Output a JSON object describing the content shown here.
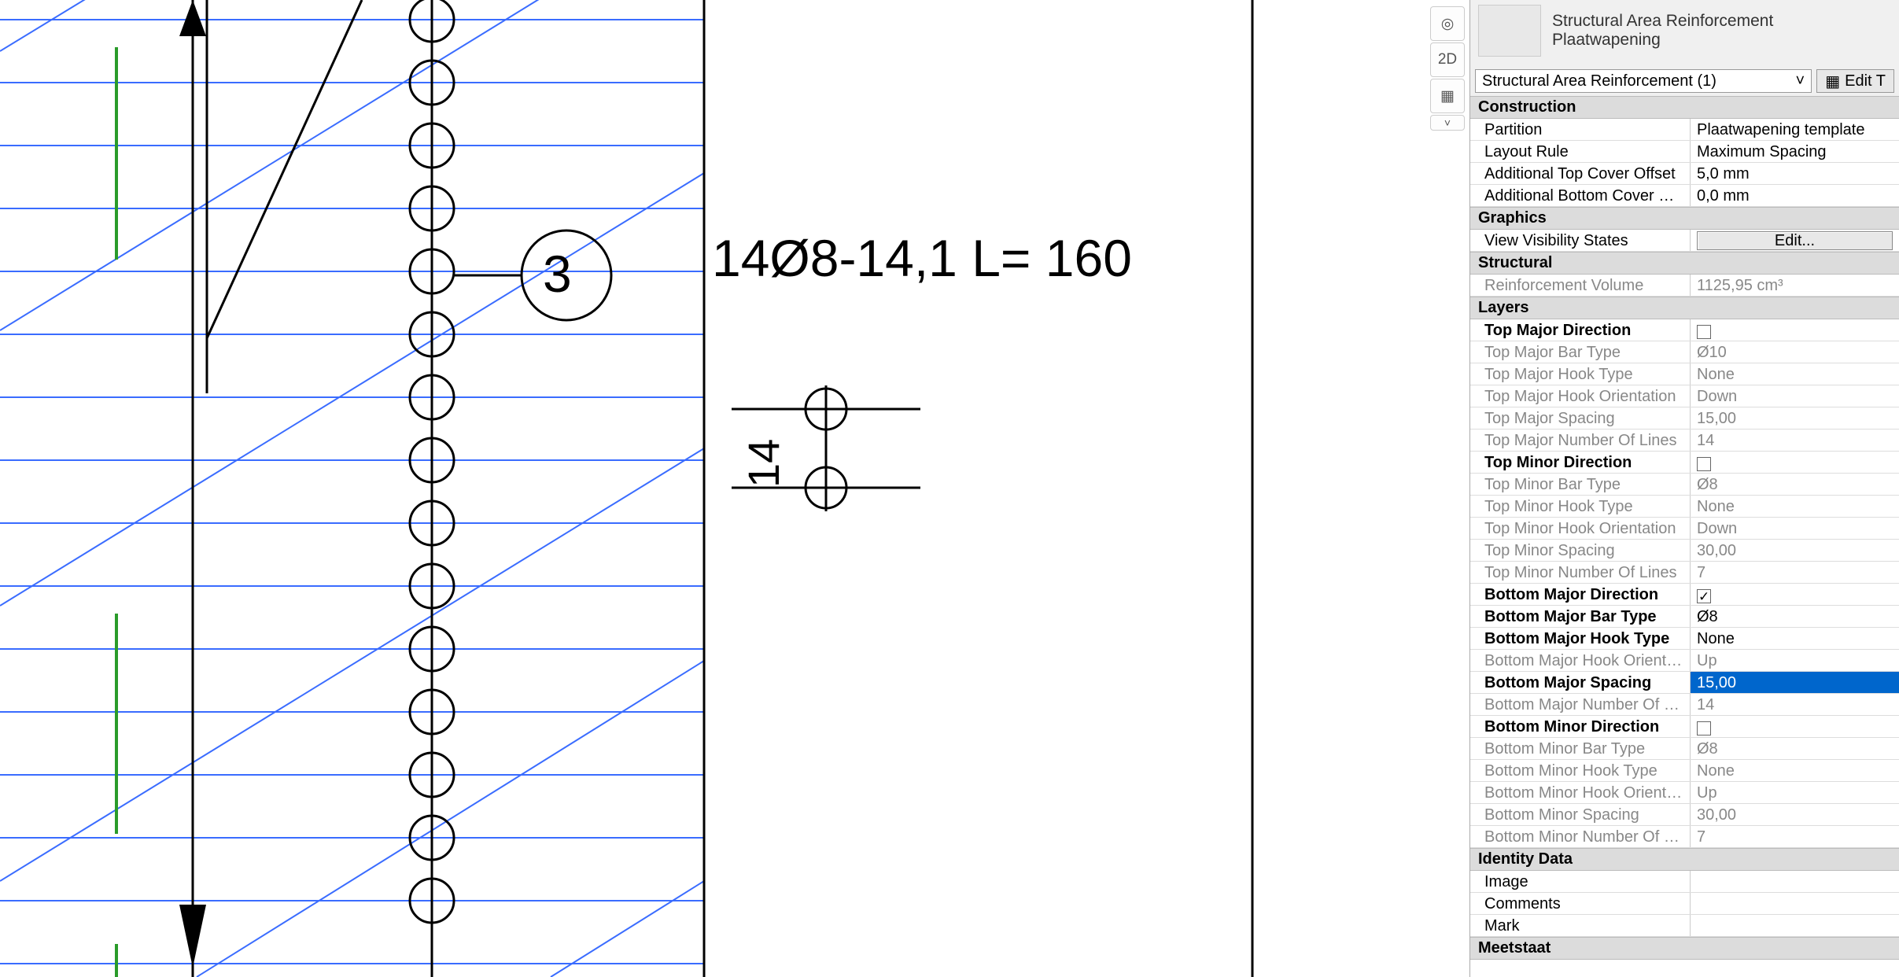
{
  "type_header": {
    "title1": "Structural Area Reinforcement",
    "title2": "Plaatwapening"
  },
  "type_selector": "Structural Area Reinforcement (1)",
  "edit_type_label": "Edit T",
  "nav": {
    "home_tip": "◎",
    "view2d": "2D",
    "navcube": "▦",
    "chevron": "˅"
  },
  "drawing": {
    "annotation": "14Ø8-14,1 L= 160",
    "bubble_num": "3",
    "dim_value": "14"
  },
  "groups": [
    {
      "kind": "group",
      "label": "Construction"
    },
    {
      "kind": "prop",
      "label": "Partition",
      "value": "Plaatwapening template",
      "bold": false
    },
    {
      "kind": "prop",
      "label": "Layout Rule",
      "value": "Maximum Spacing",
      "bold": false
    },
    {
      "kind": "prop",
      "label": "Additional Top Cover Offset",
      "value": "5,0 mm",
      "bold": false
    },
    {
      "kind": "prop",
      "label": "Additional Bottom Cover Offset",
      "value": "0,0 mm",
      "bold": false
    },
    {
      "kind": "group",
      "label": "Graphics"
    },
    {
      "kind": "prop",
      "label": "View Visibility States",
      "value": "Edit...",
      "button": true
    },
    {
      "kind": "group",
      "label": "Structural"
    },
    {
      "kind": "prop",
      "label": "Reinforcement Volume",
      "value": "1125,95 cm³",
      "dimlabel": true,
      "dimvalue": true
    },
    {
      "kind": "group",
      "label": "Layers"
    },
    {
      "kind": "prop",
      "label": "Top Major Direction",
      "value": "",
      "checkbox": true,
      "checked": false,
      "bold": true
    },
    {
      "kind": "prop",
      "label": "Top Major Bar Type",
      "value": "Ø10",
      "dimlabel": true,
      "dimvalue": true
    },
    {
      "kind": "prop",
      "label": "Top Major Hook Type",
      "value": "None",
      "dimlabel": true,
      "dimvalue": true
    },
    {
      "kind": "prop",
      "label": "Top Major Hook Orientation",
      "value": "Down",
      "dimlabel": true,
      "dimvalue": true
    },
    {
      "kind": "prop",
      "label": "Top Major Spacing",
      "value": "15,00",
      "dimlabel": true,
      "dimvalue": true
    },
    {
      "kind": "prop",
      "label": "Top Major Number Of Lines",
      "value": "14",
      "dimlabel": true,
      "dimvalue": true
    },
    {
      "kind": "prop",
      "label": "Top Minor Direction",
      "value": "",
      "checkbox": true,
      "checked": false,
      "bold": true
    },
    {
      "kind": "prop",
      "label": "Top Minor Bar Type",
      "value": "Ø8",
      "dimlabel": true,
      "dimvalue": true
    },
    {
      "kind": "prop",
      "label": "Top Minor Hook Type",
      "value": "None",
      "dimlabel": true,
      "dimvalue": true
    },
    {
      "kind": "prop",
      "label": "Top Minor Hook Orientation",
      "value": "Down",
      "dimlabel": true,
      "dimvalue": true
    },
    {
      "kind": "prop",
      "label": "Top Minor Spacing",
      "value": "30,00",
      "dimlabel": true,
      "dimvalue": true
    },
    {
      "kind": "prop",
      "label": "Top Minor Number Of Lines",
      "value": "7",
      "dimlabel": true,
      "dimvalue": true
    },
    {
      "kind": "prop",
      "label": "Bottom Major Direction",
      "value": "",
      "checkbox": true,
      "checked": true,
      "bold": true
    },
    {
      "kind": "prop",
      "label": "Bottom Major Bar Type",
      "value": "Ø8",
      "bold": true
    },
    {
      "kind": "prop",
      "label": "Bottom Major Hook Type",
      "value": "None",
      "bold": true
    },
    {
      "kind": "prop",
      "label": "Bottom Major Hook Orientati...",
      "value": "Up",
      "dimlabel": true,
      "dimvalue": true
    },
    {
      "kind": "prop",
      "label": "Bottom Major Spacing",
      "value": "15,00",
      "bold": true,
      "highlight": true
    },
    {
      "kind": "prop",
      "label": "Bottom Major Number Of Lines",
      "value": "14",
      "dimlabel": true,
      "dimvalue": true
    },
    {
      "kind": "prop",
      "label": "Bottom Minor Direction",
      "value": "",
      "checkbox": true,
      "checked": false,
      "bold": true
    },
    {
      "kind": "prop",
      "label": "Bottom Minor Bar Type",
      "value": "Ø8",
      "dimlabel": true,
      "dimvalue": true
    },
    {
      "kind": "prop",
      "label": "Bottom Minor Hook Type",
      "value": "None",
      "dimlabel": true,
      "dimvalue": true
    },
    {
      "kind": "prop",
      "label": "Bottom Minor Hook Orientati...",
      "value": "Up",
      "dimlabel": true,
      "dimvalue": true
    },
    {
      "kind": "prop",
      "label": "Bottom Minor Spacing",
      "value": "30,00",
      "dimlabel": true,
      "dimvalue": true
    },
    {
      "kind": "prop",
      "label": "Bottom Minor Number Of Lin...",
      "value": "7",
      "dimlabel": true,
      "dimvalue": true
    },
    {
      "kind": "group",
      "label": "Identity Data"
    },
    {
      "kind": "prop",
      "label": "Image",
      "value": ""
    },
    {
      "kind": "prop",
      "label": "Comments",
      "value": ""
    },
    {
      "kind": "prop",
      "label": "Mark",
      "value": ""
    },
    {
      "kind": "group",
      "label": "Meetstaat"
    }
  ]
}
